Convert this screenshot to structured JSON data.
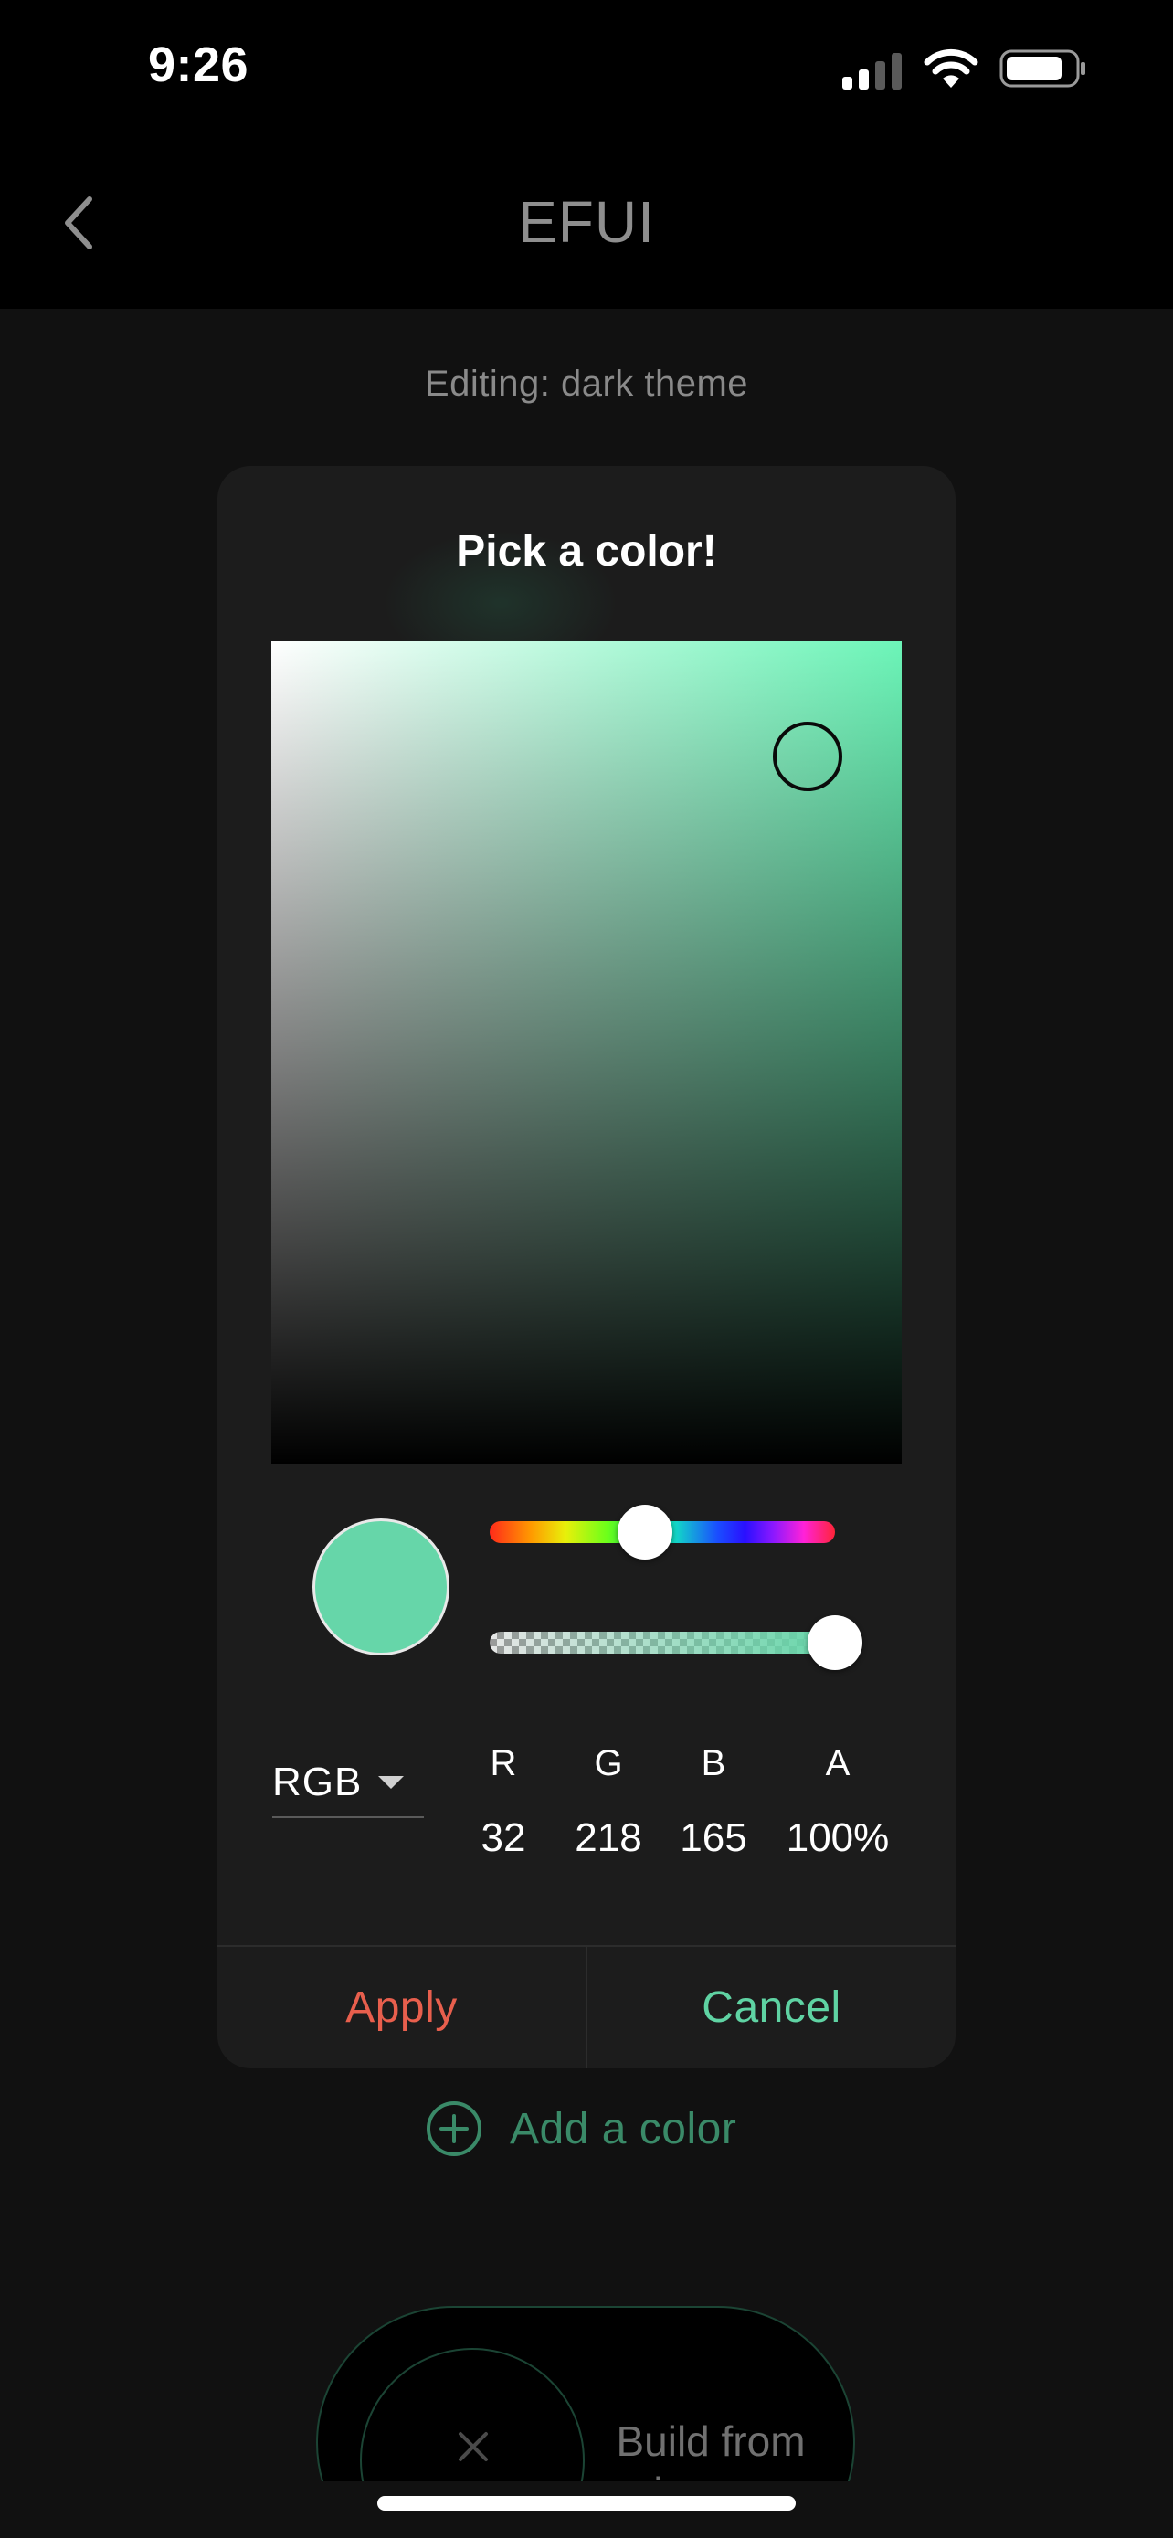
{
  "status_bar": {
    "time": "9:26"
  },
  "nav": {
    "title": "EFUI",
    "back_icon": "chevron-left-icon"
  },
  "editing_label": "Editing: dark theme",
  "picker": {
    "title": "Pick a color!",
    "current_color": "#66d6a9",
    "saturation": 0.85,
    "brightness": 0.86,
    "hue": 158,
    "hue_position": 0.45,
    "alpha_position": 1.0,
    "mode": "RGB",
    "channels": [
      {
        "label": "R",
        "value": "32"
      },
      {
        "label": "G",
        "value": "218"
      },
      {
        "label": "B",
        "value": "165"
      },
      {
        "label": "A",
        "value": "100%"
      }
    ],
    "apply_label": "Apply",
    "cancel_label": "Cancel"
  },
  "add_color": {
    "label": "Add a color",
    "icon": "plus-circle-icon"
  },
  "build_from_image": {
    "label": "Build from image",
    "icon": "close-icon"
  },
  "colors": {
    "background": "#111111",
    "dialog": "#1c1c1c",
    "apply": "#e85f4d",
    "cancel": "#5fd3a3",
    "add_accent": "#3a8a68"
  }
}
